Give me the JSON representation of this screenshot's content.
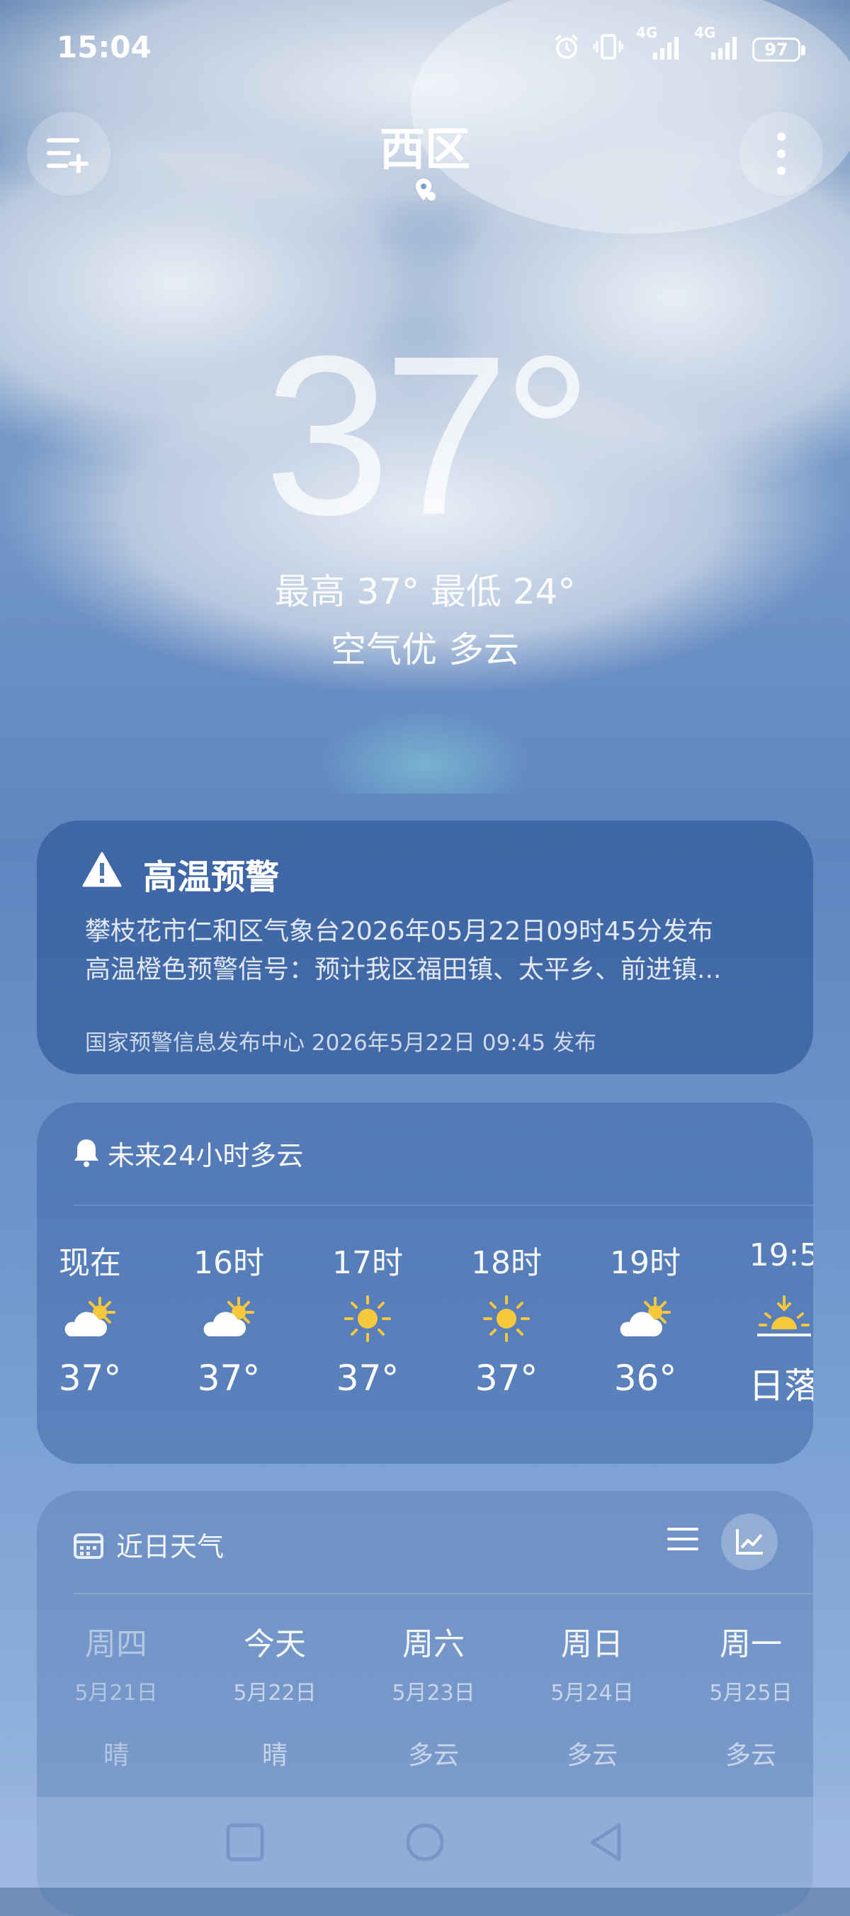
{
  "status_bar": {
    "time": "15:04",
    "battery": "97",
    "net1": "4G",
    "net2": "4G"
  },
  "location": {
    "city": "西区"
  },
  "current": {
    "temperature": "37°",
    "hilo": "最高 37° 最低 24°",
    "condition": "空气优  多云"
  },
  "alert": {
    "title": "高温预警",
    "line1": "攀枝花市仁和区气象台2026年05月22日09时45分发布",
    "line2": "高温橙色预警信号：预计我区福田镇、太平乡、前进镇...",
    "source": "国家预警信息发布中心 2026年5月22日 09:45 发布"
  },
  "hourly": {
    "header": "未来24小时多云",
    "items": [
      {
        "label": "现在",
        "icon": "partly-cloudy-icon",
        "temp": "37°"
      },
      {
        "label": "16时",
        "icon": "partly-cloudy-icon",
        "temp": "37°"
      },
      {
        "label": "17时",
        "icon": "sunny-icon",
        "temp": "37°"
      },
      {
        "label": "18时",
        "icon": "sunny-icon",
        "temp": "37°"
      },
      {
        "label": "19时",
        "icon": "partly-cloudy-icon",
        "temp": "36°"
      },
      {
        "label": "19:5",
        "icon": "sunset-icon",
        "temp": "日落"
      }
    ]
  },
  "daily": {
    "header": "近日天气",
    "items": [
      {
        "day": "周四",
        "date": "5月21日",
        "weather": "晴"
      },
      {
        "day": "今天",
        "date": "5月22日",
        "weather": "晴"
      },
      {
        "day": "周六",
        "date": "5月23日",
        "weather": "多云"
      },
      {
        "day": "周日",
        "date": "5月24日",
        "weather": "多云"
      },
      {
        "day": "周一",
        "date": "5月25日",
        "weather": "多云"
      }
    ]
  },
  "colors": {
    "sun": "#f7c83c",
    "cloud": "#ffffff"
  }
}
